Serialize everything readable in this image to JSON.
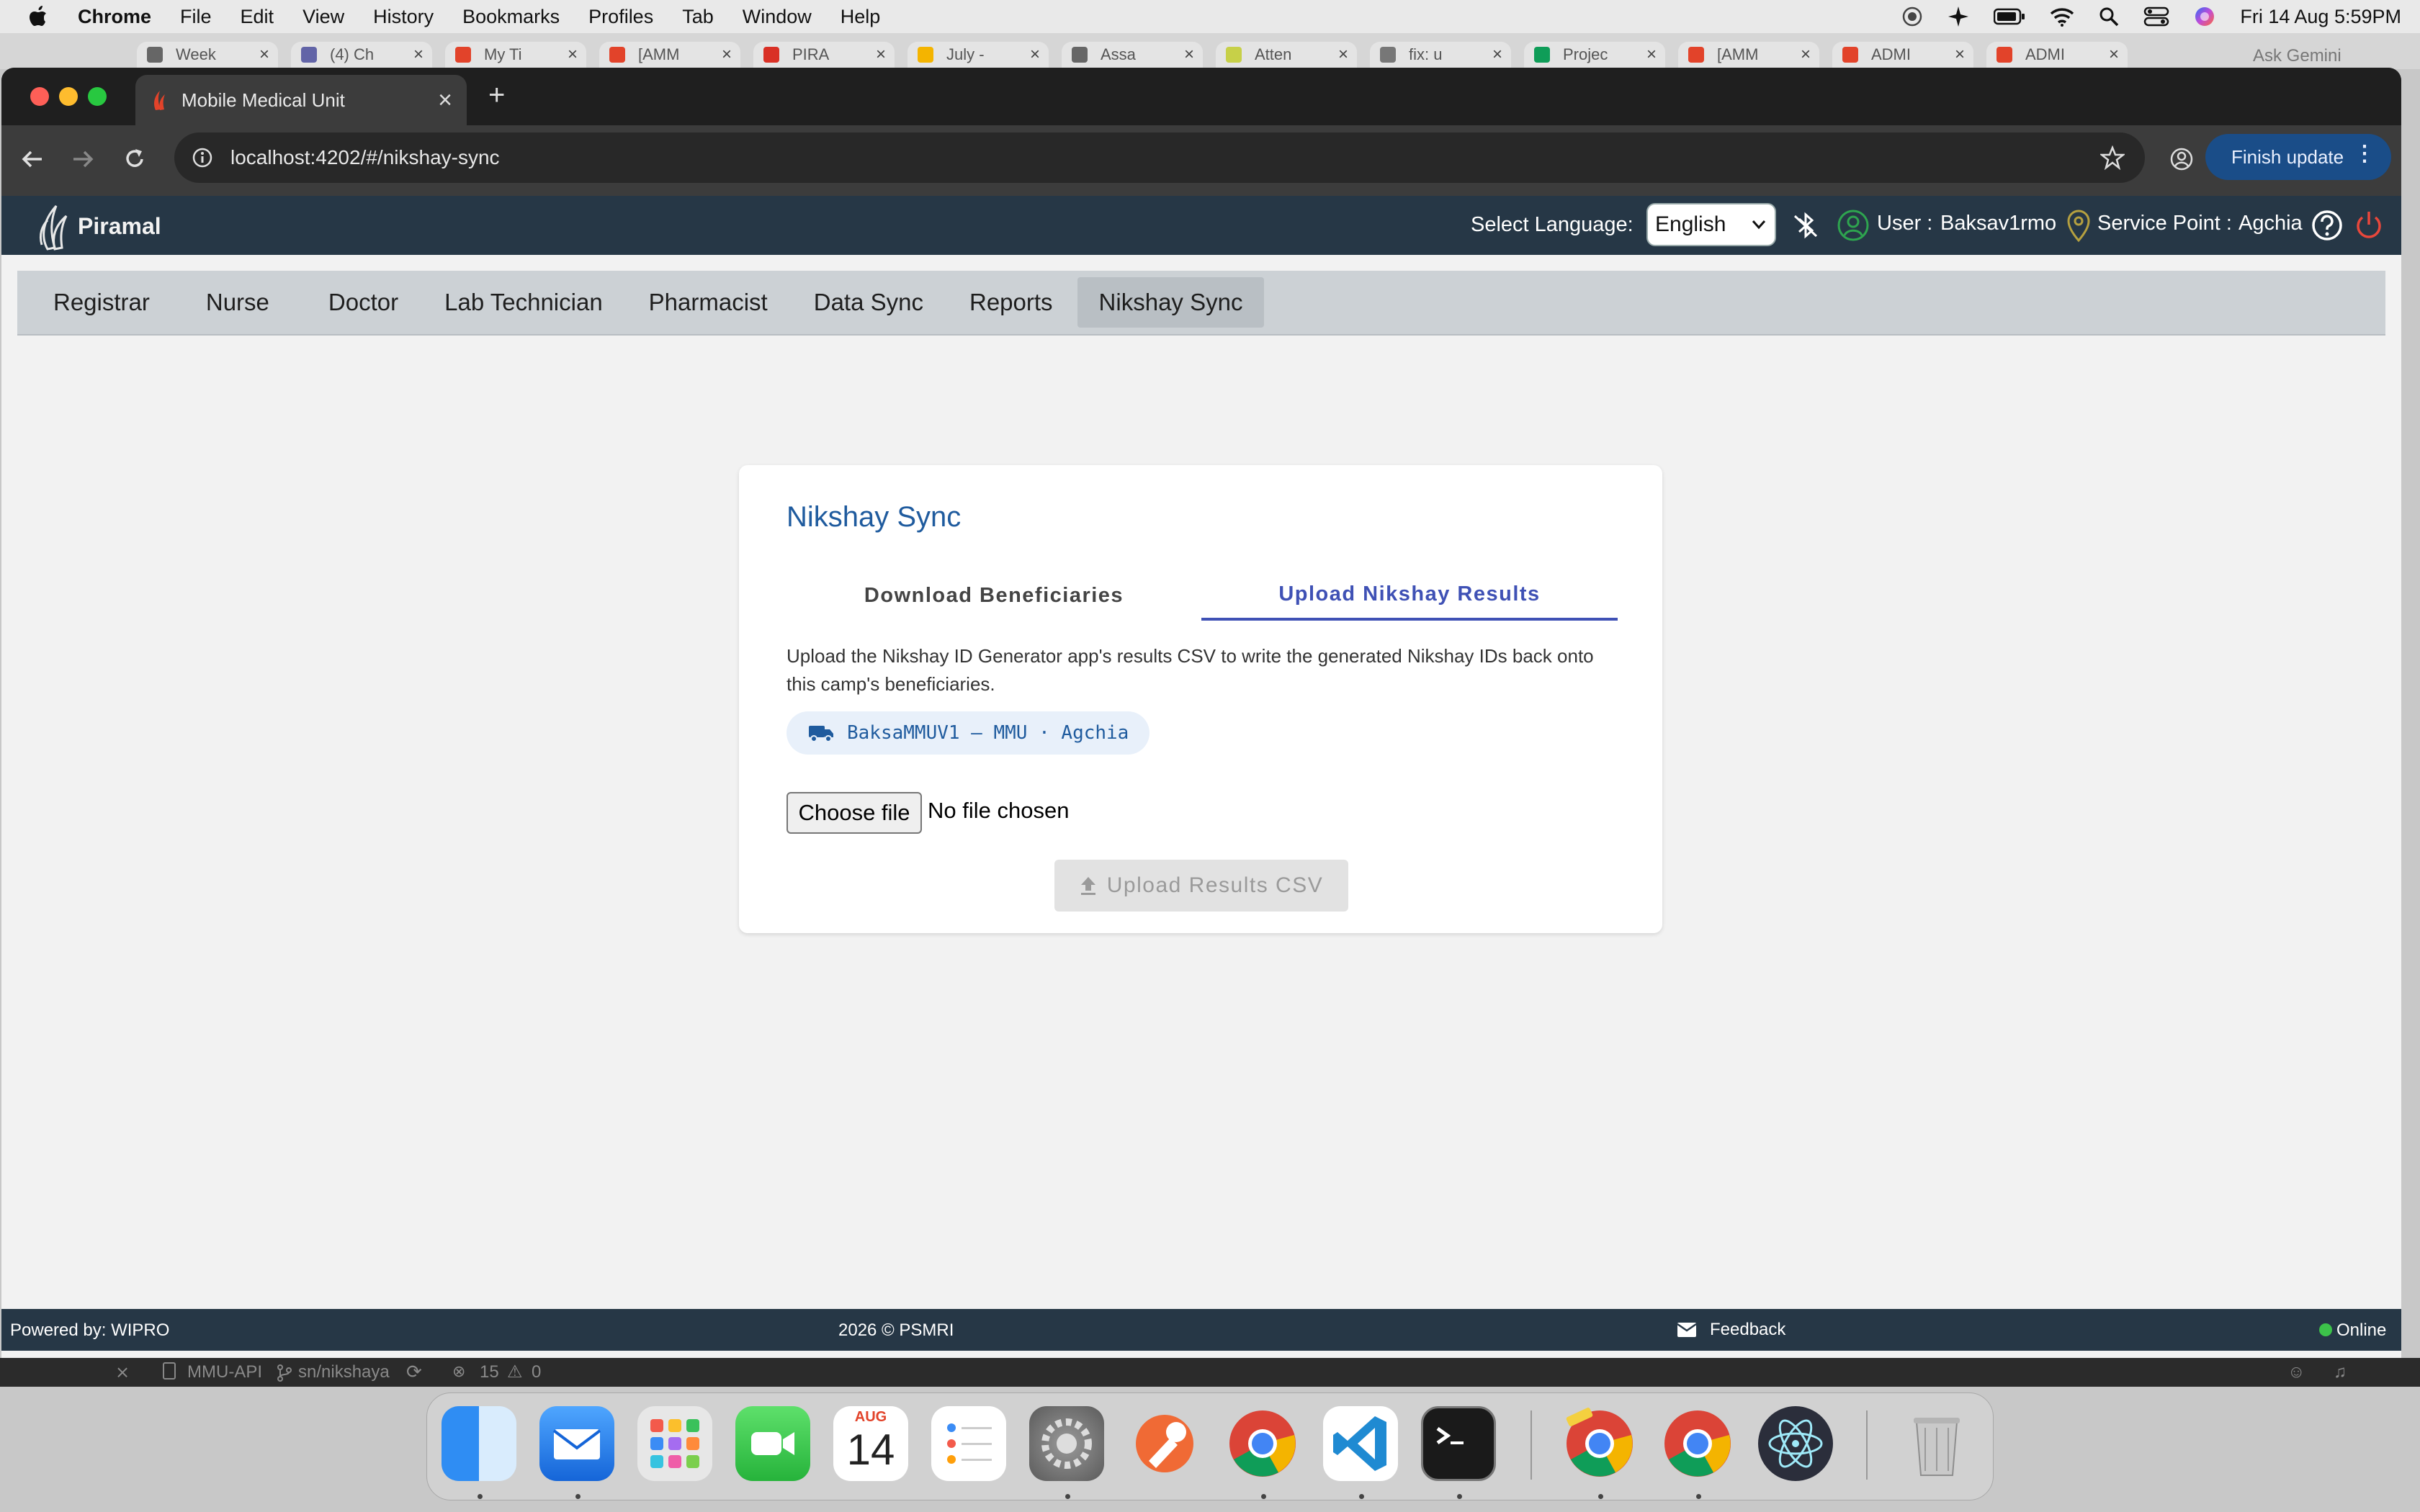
{
  "menubar": {
    "app_name": "Chrome",
    "items": [
      "File",
      "Edit",
      "View",
      "History",
      "Bookmarks",
      "Profiles",
      "Tab",
      "Window",
      "Help"
    ],
    "clock": "Fri 14 Aug  5:59PM"
  },
  "background_tabs": [
    "Week",
    "(4) Ch",
    "My Ti",
    "[AMM",
    "PIRA",
    "July -",
    "Assa",
    "Atten",
    "fix: u",
    "Projec",
    "[AMM",
    "ADMI",
    "ADMI"
  ],
  "ask_gemini": "Ask Gemini",
  "browser": {
    "tab_title": "Mobile Medical Unit",
    "url": "localhost:4202/#/nikshay-sync",
    "finish_update": "Finish update"
  },
  "header": {
    "logo_text": "Piramal",
    "select_language_label": "Select Language:",
    "language_value": "English",
    "language_options": [
      "English"
    ],
    "user_label": "User :",
    "user_name": "Baksav1rmo",
    "service_point_label": "Service Point :",
    "service_point_name": "Agchia"
  },
  "nav": {
    "items": [
      "Registrar",
      "Nurse",
      "Doctor",
      "Lab Technician",
      "Pharmacist",
      "Data Sync",
      "Reports",
      "Nikshay Sync"
    ],
    "active": "Nikshay Sync"
  },
  "card": {
    "title": "Nikshay Sync",
    "tabs": [
      "Download Beneficiaries",
      "Upload Nikshay Results"
    ],
    "active_tab": "Upload Nikshay Results",
    "description": "Upload the Nikshay ID Generator app's results CSV to write the generated Nikshay IDs back onto this camp's beneficiaries.",
    "van_chip": "BaksaMMUV1 — MMU · Agchia",
    "choose_file": "Choose file",
    "no_file": "No file chosen",
    "upload_button": "Upload Results CSV"
  },
  "footer": {
    "powered_by": "Powered by: WIPRO",
    "copyright": "2026 © PSMRI",
    "feedback": "Feedback",
    "status": "Online"
  },
  "vscode_status": {
    "project": "MMU-API",
    "branch": "sn/nikshaya",
    "errors": "15",
    "warnings": "0"
  },
  "dock": {
    "calendar_month": "AUG",
    "calendar_day": "14"
  },
  "colors": {
    "app_header": "#263746",
    "accent_blue": "#3f51b5",
    "title_blue": "#1f5b9e",
    "online_green": "#3cc24a",
    "power_red": "#e8473b"
  }
}
